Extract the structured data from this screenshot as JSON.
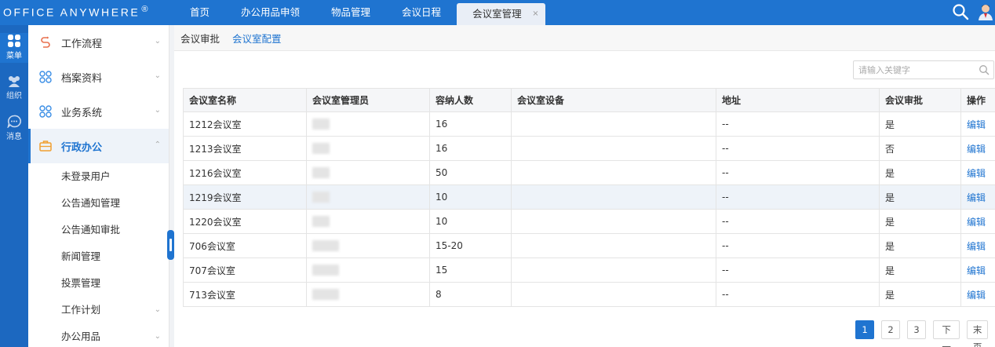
{
  "app": {
    "logo": "OFFICE ANYWHERE",
    "logo_mark": "®"
  },
  "tabs": [
    {
      "label": "首页"
    },
    {
      "label": "办公用品申领"
    },
    {
      "label": "物品管理"
    },
    {
      "label": "会议日程"
    },
    {
      "label": "会议室管理",
      "close": "×"
    }
  ],
  "rail": [
    {
      "label": "菜单"
    },
    {
      "label": "组织"
    },
    {
      "label": "消息"
    }
  ],
  "sidebar": {
    "groups": [
      {
        "label": "工作流程"
      },
      {
        "label": "档案资料"
      },
      {
        "label": "业务系统"
      },
      {
        "label": "行政办公"
      }
    ],
    "sub_items": [
      {
        "label": "未登录用户"
      },
      {
        "label": "公告通知管理"
      },
      {
        "label": "公告通知审批"
      },
      {
        "label": "新闻管理"
      },
      {
        "label": "投票管理"
      },
      {
        "label": "工作计划"
      },
      {
        "label": "办公用品"
      }
    ]
  },
  "subnav": {
    "items": [
      "会议审批",
      "会议室配置"
    ]
  },
  "search": {
    "placeholder": "请输入关键字"
  },
  "table": {
    "headers": [
      "会议室名称",
      "会议室管理员",
      "容纳人数",
      "会议室设备",
      "地址",
      "会议审批",
      "操作"
    ],
    "rows": [
      {
        "name": "1212会议室",
        "capacity": "16",
        "equipment": "",
        "address": "--",
        "approval": "是",
        "action": "编辑"
      },
      {
        "name": "1213会议室",
        "capacity": "16",
        "equipment": "",
        "address": "--",
        "approval": "否",
        "action": "编辑"
      },
      {
        "name": "1216会议室",
        "capacity": "50",
        "equipment": "",
        "address": "--",
        "approval": "是",
        "action": "编辑"
      },
      {
        "name": "1219会议室",
        "capacity": "10",
        "equipment": "",
        "address": "--",
        "approval": "是",
        "action": "编辑"
      },
      {
        "name": "1220会议室",
        "capacity": "10",
        "equipment": "",
        "address": "--",
        "approval": "是",
        "action": "编辑"
      },
      {
        "name": "706会议室",
        "capacity": "15-20",
        "equipment": "",
        "address": "--",
        "approval": "是",
        "action": "编辑"
      },
      {
        "name": "707会议室",
        "capacity": "15",
        "equipment": "",
        "address": "--",
        "approval": "是",
        "action": "编辑"
      },
      {
        "name": "713会议室",
        "capacity": "8",
        "equipment": "",
        "address": "--",
        "approval": "是",
        "action": "编辑"
      }
    ]
  },
  "pager": {
    "pages": [
      "1",
      "2",
      "3"
    ],
    "next": "下一页",
    "last": "末页"
  },
  "colors": {
    "brand": "#1f74d0",
    "rail": "#1c68c0"
  }
}
